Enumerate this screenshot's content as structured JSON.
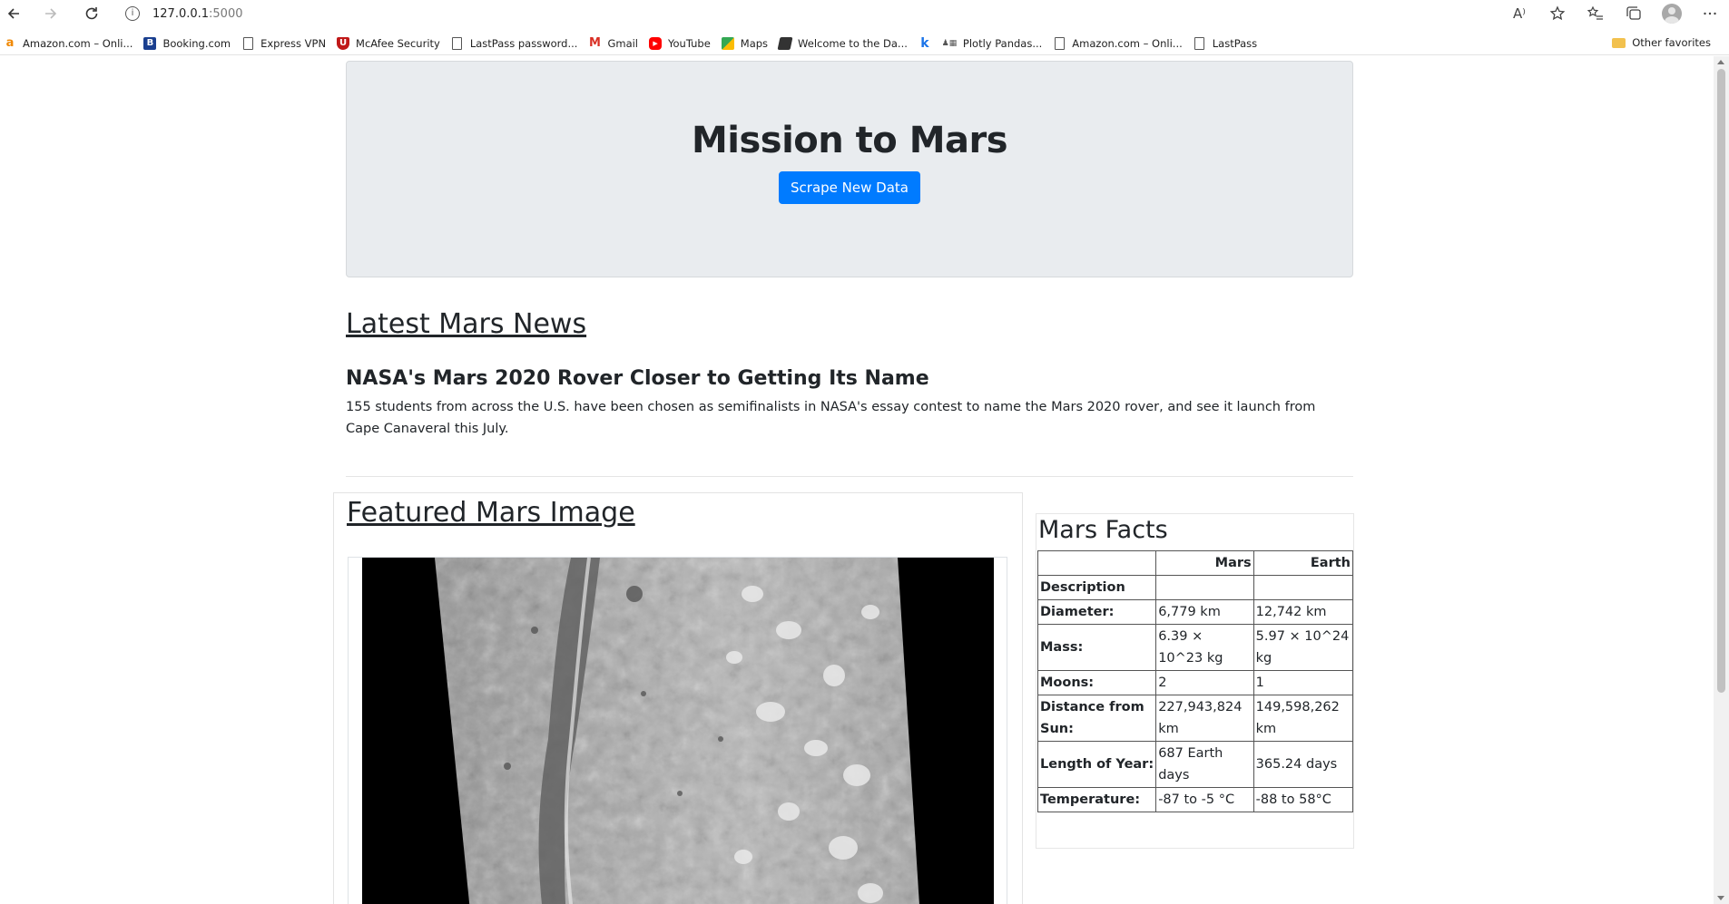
{
  "browser": {
    "url_host": "127.0.0.1",
    "url_port": ":5000",
    "bookmarks": [
      {
        "label": "Amazon.com – Onli...",
        "icon": "amazon-icon"
      },
      {
        "label": "Booking.com",
        "icon": "booking-icon"
      },
      {
        "label": "Express VPN",
        "icon": "page-icon"
      },
      {
        "label": "McAfee Security",
        "icon": "mcafee-icon"
      },
      {
        "label": "LastPass password...",
        "icon": "page-icon"
      },
      {
        "label": "Gmail",
        "icon": "gmail-icon"
      },
      {
        "label": "YouTube",
        "icon": "youtube-icon"
      },
      {
        "label": "Maps",
        "icon": "maps-icon"
      },
      {
        "label": "Welcome to the Da...",
        "icon": "book-icon"
      },
      {
        "label": "",
        "icon": "k-icon"
      },
      {
        "label": "Plotly Pandas...",
        "icon": "plotly-icon"
      },
      {
        "label": "Amazon.com – Onli...",
        "icon": "page-icon"
      },
      {
        "label": "LastPass",
        "icon": "page-icon"
      }
    ],
    "other_favorites": "Other favorites",
    "read_aloud_glyph": "A⁾"
  },
  "header": {
    "title": "Mission to Mars",
    "button_label": "Scrape New Data"
  },
  "news": {
    "heading": "Latest Mars News",
    "title": "NASA's Mars 2020 Rover Closer to Getting Its Name",
    "paragraph": "155 students from across the U.S. have been chosen as semifinalists in NASA's essay contest to name the Mars 2020 rover, and see it launch from Cape Canaveral this July."
  },
  "featured": {
    "heading": "Featured Mars Image"
  },
  "facts": {
    "heading": "Mars Facts",
    "columns": [
      "",
      "Mars",
      "Earth"
    ],
    "index_label": "Description",
    "rows": [
      {
        "label": "Diameter:",
        "mars": "6,779 km",
        "earth": "12,742 km"
      },
      {
        "label": "Mass:",
        "mars": "6.39 × 10^23 kg",
        "earth": "5.97 × 10^24 kg"
      },
      {
        "label": "Moons:",
        "mars": "2",
        "earth": "1"
      },
      {
        "label": "Distance from Sun:",
        "mars": "227,943,824 km",
        "earth": "149,598,262 km"
      },
      {
        "label": "Length of Year:",
        "mars": "687 Earth days",
        "earth": "365.24 days"
      },
      {
        "label": "Temperature:",
        "mars": "-87 to -5 °C",
        "earth": "-88 to 58°C"
      }
    ]
  }
}
